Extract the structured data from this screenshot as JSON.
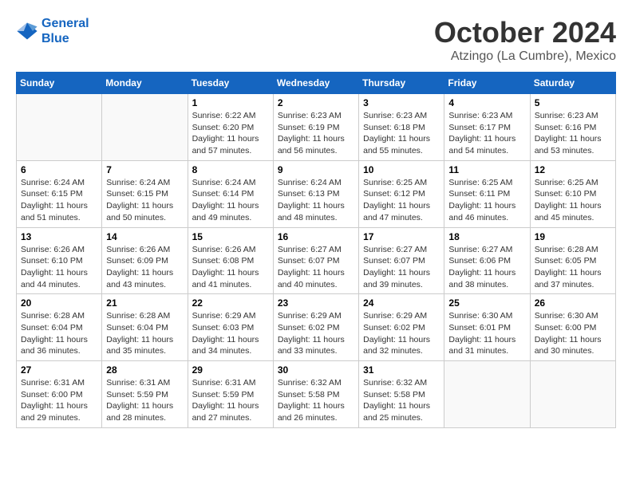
{
  "logo": {
    "line1": "General",
    "line2": "Blue"
  },
  "title": "October 2024",
  "location": "Atzingo (La Cumbre), Mexico",
  "weekdays": [
    "Sunday",
    "Monday",
    "Tuesday",
    "Wednesday",
    "Thursday",
    "Friday",
    "Saturday"
  ],
  "weeks": [
    [
      {
        "day": "",
        "sunrise": "",
        "sunset": "",
        "daylight": ""
      },
      {
        "day": "",
        "sunrise": "",
        "sunset": "",
        "daylight": ""
      },
      {
        "day": "1",
        "sunrise": "Sunrise: 6:22 AM",
        "sunset": "Sunset: 6:20 PM",
        "daylight": "Daylight: 11 hours and 57 minutes."
      },
      {
        "day": "2",
        "sunrise": "Sunrise: 6:23 AM",
        "sunset": "Sunset: 6:19 PM",
        "daylight": "Daylight: 11 hours and 56 minutes."
      },
      {
        "day": "3",
        "sunrise": "Sunrise: 6:23 AM",
        "sunset": "Sunset: 6:18 PM",
        "daylight": "Daylight: 11 hours and 55 minutes."
      },
      {
        "day": "4",
        "sunrise": "Sunrise: 6:23 AM",
        "sunset": "Sunset: 6:17 PM",
        "daylight": "Daylight: 11 hours and 54 minutes."
      },
      {
        "day": "5",
        "sunrise": "Sunrise: 6:23 AM",
        "sunset": "Sunset: 6:16 PM",
        "daylight": "Daylight: 11 hours and 53 minutes."
      }
    ],
    [
      {
        "day": "6",
        "sunrise": "Sunrise: 6:24 AM",
        "sunset": "Sunset: 6:15 PM",
        "daylight": "Daylight: 11 hours and 51 minutes."
      },
      {
        "day": "7",
        "sunrise": "Sunrise: 6:24 AM",
        "sunset": "Sunset: 6:15 PM",
        "daylight": "Daylight: 11 hours and 50 minutes."
      },
      {
        "day": "8",
        "sunrise": "Sunrise: 6:24 AM",
        "sunset": "Sunset: 6:14 PM",
        "daylight": "Daylight: 11 hours and 49 minutes."
      },
      {
        "day": "9",
        "sunrise": "Sunrise: 6:24 AM",
        "sunset": "Sunset: 6:13 PM",
        "daylight": "Daylight: 11 hours and 48 minutes."
      },
      {
        "day": "10",
        "sunrise": "Sunrise: 6:25 AM",
        "sunset": "Sunset: 6:12 PM",
        "daylight": "Daylight: 11 hours and 47 minutes."
      },
      {
        "day": "11",
        "sunrise": "Sunrise: 6:25 AM",
        "sunset": "Sunset: 6:11 PM",
        "daylight": "Daylight: 11 hours and 46 minutes."
      },
      {
        "day": "12",
        "sunrise": "Sunrise: 6:25 AM",
        "sunset": "Sunset: 6:10 PM",
        "daylight": "Daylight: 11 hours and 45 minutes."
      }
    ],
    [
      {
        "day": "13",
        "sunrise": "Sunrise: 6:26 AM",
        "sunset": "Sunset: 6:10 PM",
        "daylight": "Daylight: 11 hours and 44 minutes."
      },
      {
        "day": "14",
        "sunrise": "Sunrise: 6:26 AM",
        "sunset": "Sunset: 6:09 PM",
        "daylight": "Daylight: 11 hours and 43 minutes."
      },
      {
        "day": "15",
        "sunrise": "Sunrise: 6:26 AM",
        "sunset": "Sunset: 6:08 PM",
        "daylight": "Daylight: 11 hours and 41 minutes."
      },
      {
        "day": "16",
        "sunrise": "Sunrise: 6:27 AM",
        "sunset": "Sunset: 6:07 PM",
        "daylight": "Daylight: 11 hours and 40 minutes."
      },
      {
        "day": "17",
        "sunrise": "Sunrise: 6:27 AM",
        "sunset": "Sunset: 6:07 PM",
        "daylight": "Daylight: 11 hours and 39 minutes."
      },
      {
        "day": "18",
        "sunrise": "Sunrise: 6:27 AM",
        "sunset": "Sunset: 6:06 PM",
        "daylight": "Daylight: 11 hours and 38 minutes."
      },
      {
        "day": "19",
        "sunrise": "Sunrise: 6:28 AM",
        "sunset": "Sunset: 6:05 PM",
        "daylight": "Daylight: 11 hours and 37 minutes."
      }
    ],
    [
      {
        "day": "20",
        "sunrise": "Sunrise: 6:28 AM",
        "sunset": "Sunset: 6:04 PM",
        "daylight": "Daylight: 11 hours and 36 minutes."
      },
      {
        "day": "21",
        "sunrise": "Sunrise: 6:28 AM",
        "sunset": "Sunset: 6:04 PM",
        "daylight": "Daylight: 11 hours and 35 minutes."
      },
      {
        "day": "22",
        "sunrise": "Sunrise: 6:29 AM",
        "sunset": "Sunset: 6:03 PM",
        "daylight": "Daylight: 11 hours and 34 minutes."
      },
      {
        "day": "23",
        "sunrise": "Sunrise: 6:29 AM",
        "sunset": "Sunset: 6:02 PM",
        "daylight": "Daylight: 11 hours and 33 minutes."
      },
      {
        "day": "24",
        "sunrise": "Sunrise: 6:29 AM",
        "sunset": "Sunset: 6:02 PM",
        "daylight": "Daylight: 11 hours and 32 minutes."
      },
      {
        "day": "25",
        "sunrise": "Sunrise: 6:30 AM",
        "sunset": "Sunset: 6:01 PM",
        "daylight": "Daylight: 11 hours and 31 minutes."
      },
      {
        "day": "26",
        "sunrise": "Sunrise: 6:30 AM",
        "sunset": "Sunset: 6:00 PM",
        "daylight": "Daylight: 11 hours and 30 minutes."
      }
    ],
    [
      {
        "day": "27",
        "sunrise": "Sunrise: 6:31 AM",
        "sunset": "Sunset: 6:00 PM",
        "daylight": "Daylight: 11 hours and 29 minutes."
      },
      {
        "day": "28",
        "sunrise": "Sunrise: 6:31 AM",
        "sunset": "Sunset: 5:59 PM",
        "daylight": "Daylight: 11 hours and 28 minutes."
      },
      {
        "day": "29",
        "sunrise": "Sunrise: 6:31 AM",
        "sunset": "Sunset: 5:59 PM",
        "daylight": "Daylight: 11 hours and 27 minutes."
      },
      {
        "day": "30",
        "sunrise": "Sunrise: 6:32 AM",
        "sunset": "Sunset: 5:58 PM",
        "daylight": "Daylight: 11 hours and 26 minutes."
      },
      {
        "day": "31",
        "sunrise": "Sunrise: 6:32 AM",
        "sunset": "Sunset: 5:58 PM",
        "daylight": "Daylight: 11 hours and 25 minutes."
      },
      {
        "day": "",
        "sunrise": "",
        "sunset": "",
        "daylight": ""
      },
      {
        "day": "",
        "sunrise": "",
        "sunset": "",
        "daylight": ""
      }
    ]
  ]
}
